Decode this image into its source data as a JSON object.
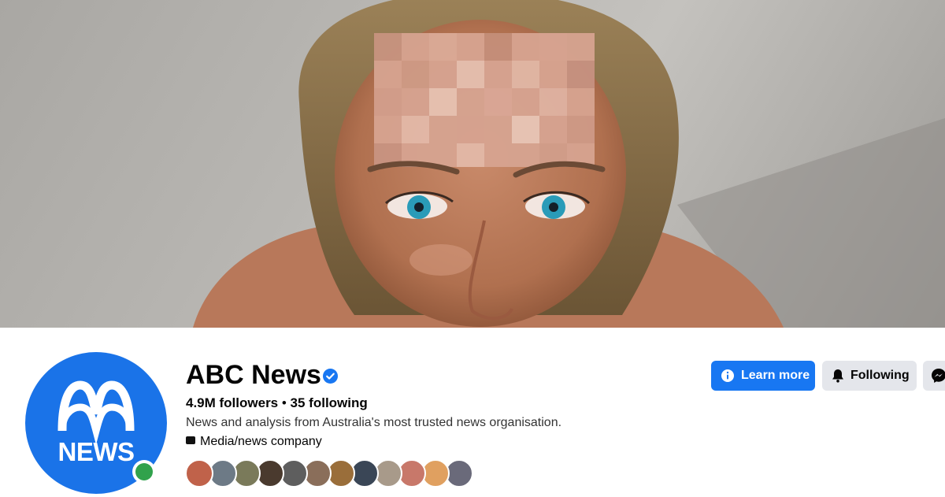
{
  "cover": {
    "description_icon": "cover-photo"
  },
  "page": {
    "name": "ABC News",
    "verified_icon": "verified-badge-icon",
    "followers": "4.9M followers",
    "separator": " • ",
    "following": "35 following",
    "bio": "News and analysis from Australia's most trusted news organisation.",
    "category": "Media/news company",
    "category_icon": "briefcase-icon"
  },
  "avatar": {
    "logo_text": "NEWS",
    "logo_icon": "abc-logo-icon",
    "status": "online"
  },
  "buttons": {
    "learn_more": "Learn more",
    "learn_more_icon": "info-icon",
    "following": "Following",
    "following_icon": "bell-icon",
    "message_icon": "messenger-icon"
  },
  "colors": {
    "accent": "#1877f2",
    "avatar_bg": "#1a73e8",
    "online": "#31a24c",
    "secondary_button": "#e4e6eb"
  },
  "follower_avatars": [
    {
      "color": "#c0624a"
    },
    {
      "color": "#6d7a86"
    },
    {
      "color": "#7a7a5a"
    },
    {
      "color": "#4a3a2e"
    },
    {
      "color": "#5e5e5e"
    },
    {
      "color": "#8a6e5a"
    },
    {
      "color": "#9a6e3a"
    },
    {
      "color": "#3a4656"
    },
    {
      "color": "#a89a8a"
    },
    {
      "color": "#c8786a"
    },
    {
      "color": "#e0a060"
    },
    {
      "color": "#6a6a7a"
    }
  ]
}
